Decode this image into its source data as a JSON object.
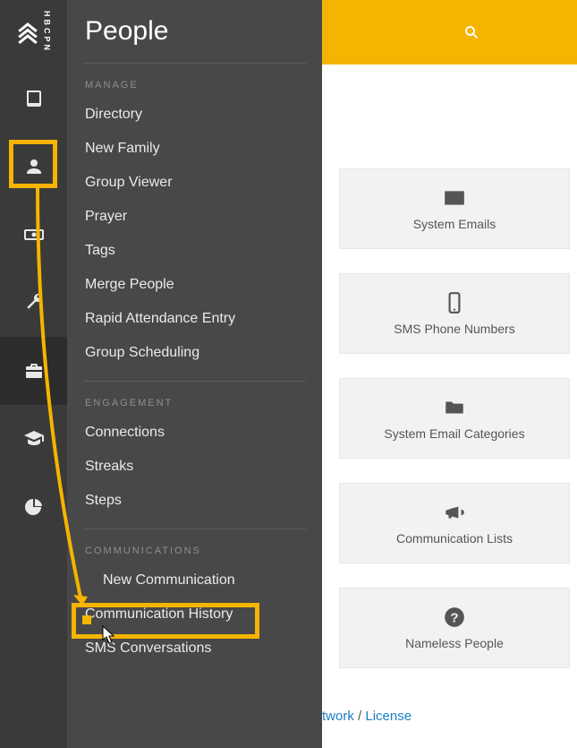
{
  "brand": {
    "acronym": "HBCPN"
  },
  "flyout": {
    "title": "People",
    "sections": {
      "manage": {
        "head": "MANAGE",
        "items": [
          "Directory",
          "New Family",
          "Group Viewer",
          "Prayer",
          "Tags",
          "Merge People",
          "Rapid Attendance Entry",
          "Group Scheduling"
        ]
      },
      "engagement": {
        "head": "ENGAGEMENT",
        "items": [
          "Connections",
          "Streaks",
          "Steps"
        ]
      },
      "communications": {
        "head": "COMMUNICATIONS",
        "items": [
          "New Communication",
          "Communication History",
          "SMS Conversations"
        ]
      }
    }
  },
  "cards": [
    {
      "label": "System Emails",
      "icon": "envelope"
    },
    {
      "label": "SMS Phone Numbers",
      "icon": "phone"
    },
    {
      "label": "System Email Categories",
      "icon": "folder"
    },
    {
      "label": "Communication Lists",
      "icon": "bullhorn"
    },
    {
      "label": "Nameless People",
      "icon": "question"
    }
  ],
  "footer": {
    "network_fragment": "twork",
    "sep": " / ",
    "license": "License"
  },
  "annotation": {
    "arrow_color": "#f4b400"
  }
}
